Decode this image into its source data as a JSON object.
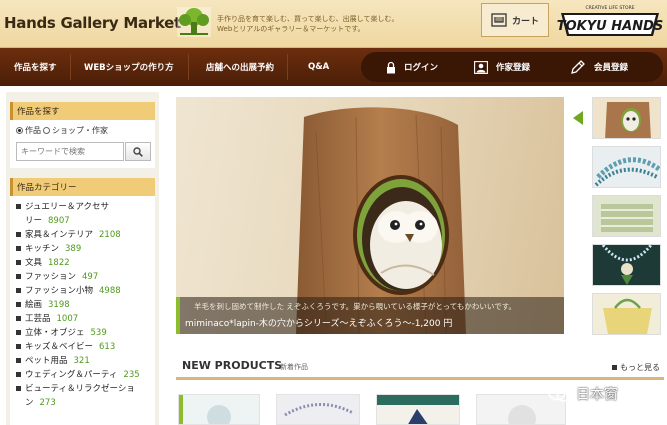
{
  "header": {
    "logo": "Hands Gallery Market",
    "tagline_line1": "手作り品を育て楽しむ、買って楽しむ、出展して楽しむ。",
    "tagline_line2": "Webとリアルのギャラリー＆マーケットです。",
    "cart_label": "カート",
    "brand_top": "CREATIVE LIFE STORE",
    "brand_name": "TOKYU HANDS"
  },
  "nav": {
    "items": [
      "作品を探す",
      "WEBショップの作り方",
      "店舗への出展予約",
      "Q&A"
    ],
    "login": "ログイン",
    "artist_register": "作家登録",
    "member_register": "会員登録"
  },
  "sidebar": {
    "search": {
      "title": "作品を探す",
      "radio_works": "作品",
      "radio_shop": "ショップ・作家",
      "placeholder": "キーワードで検索"
    },
    "categories": {
      "title": "作品カテゴリー",
      "items": [
        {
          "name": "ジュエリー＆アクセサ",
          "cont": "リー",
          "count": "8907"
        },
        {
          "name": "家具＆インテリア",
          "count": "2108"
        },
        {
          "name": "キッチン",
          "count": "389"
        },
        {
          "name": "文具",
          "count": "1822"
        },
        {
          "name": "ファッション",
          "count": "497"
        },
        {
          "name": "ファッション小物",
          "count": "4988"
        },
        {
          "name": "絵画",
          "count": "3198"
        },
        {
          "name": "工芸品",
          "count": "1007"
        },
        {
          "name": "立体・オブジェ",
          "count": "539"
        },
        {
          "name": "キッズ＆ベイビー",
          "count": "613"
        },
        {
          "name": "ペット用品",
          "count": "321"
        },
        {
          "name": "ウェディング＆パーティ",
          "count": "235"
        },
        {
          "name": "ビューティ＆リラクゼーショ",
          "cont": "ン",
          "count": "273"
        }
      ]
    }
  },
  "hero": {
    "sub": "羊毛を刺し固めて制作した えぞふくろうです。巣から覗いている様子がとってもかわいいです。",
    "title": "miminaco*lapin-木の穴からシリーズ～えぞふくろう～-1,200 円"
  },
  "new_products": {
    "title": "NEW PRODUCTS",
    "sub": "新着作品",
    "more": "もっと見る"
  },
  "watermark": "日本窗",
  "colors": {
    "nav_bg": "#5a250a",
    "accent_green": "#6ea81e",
    "sidebar_title": "#f0cb78",
    "count_green": "#4f9a1b"
  }
}
